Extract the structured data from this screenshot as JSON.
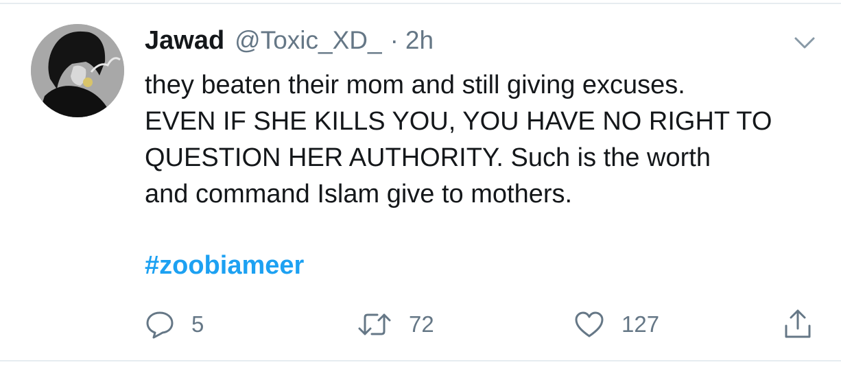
{
  "tweet": {
    "author_name": "Jawad",
    "handle": "@Toxic_XD_",
    "separator": "·",
    "time": "2h",
    "text_lines": [
      "they beaten their mom and still giving excuses.",
      "EVEN IF SHE KILLS YOU, YOU HAVE NO RIGHT TO",
      "QUESTION HER AUTHORITY. Such is the worth",
      "and command Islam give to mothers."
    ],
    "hashtag": "#zoobiameer",
    "more_icon": "chevron-down-icon"
  },
  "actions": {
    "reply": {
      "icon": "reply-icon",
      "count": "5"
    },
    "retweet": {
      "icon": "retweet-icon",
      "count": "72"
    },
    "like": {
      "icon": "heart-icon",
      "count": "127"
    },
    "share": {
      "icon": "share-icon"
    }
  },
  "colors": {
    "text": "#14171a",
    "secondary": "#657786",
    "link": "#1da1f2",
    "divider": "#e6ecf0"
  }
}
